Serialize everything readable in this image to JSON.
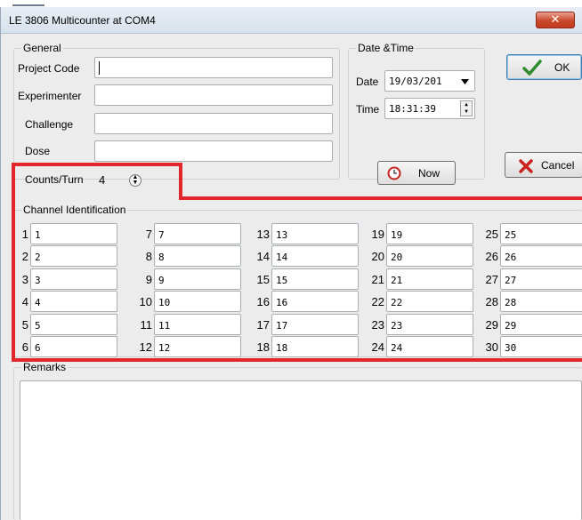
{
  "window": {
    "title": "LE 3806 Multicounter at COM4",
    "close_glyph": "✕"
  },
  "general": {
    "label": "General",
    "project_code_label": "Project Code",
    "project_code_value": "",
    "experimenter_label": "Experimenter",
    "experimenter_value": "",
    "challenge_label": "Challenge",
    "challenge_value": "",
    "dose_label": "Dose",
    "dose_value": "",
    "counts_label": "Counts/Turn",
    "counts_value": "4"
  },
  "datetime": {
    "label": "Date &Time",
    "date_label": "Date",
    "date_value": "19/03/201",
    "time_label": "Time",
    "time_value": "18:31:39",
    "now_label": "Now"
  },
  "buttons": {
    "ok_label": "OK",
    "cancel_label": "Cancel"
  },
  "channels": {
    "label": "Channel Identification",
    "items": [
      {
        "n": "1",
        "v": "1"
      },
      {
        "n": "2",
        "v": "2"
      },
      {
        "n": "3",
        "v": "3"
      },
      {
        "n": "4",
        "v": "4"
      },
      {
        "n": "5",
        "v": "5"
      },
      {
        "n": "6",
        "v": "6"
      },
      {
        "n": "7",
        "v": "7"
      },
      {
        "n": "8",
        "v": "8"
      },
      {
        "n": "9",
        "v": "9"
      },
      {
        "n": "10",
        "v": "10"
      },
      {
        "n": "11",
        "v": "11"
      },
      {
        "n": "12",
        "v": "12"
      },
      {
        "n": "13",
        "v": "13"
      },
      {
        "n": "14",
        "v": "14"
      },
      {
        "n": "15",
        "v": "15"
      },
      {
        "n": "16",
        "v": "16"
      },
      {
        "n": "17",
        "v": "17"
      },
      {
        "n": "18",
        "v": "18"
      },
      {
        "n": "19",
        "v": "19"
      },
      {
        "n": "20",
        "v": "20"
      },
      {
        "n": "21",
        "v": "21"
      },
      {
        "n": "22",
        "v": "22"
      },
      {
        "n": "23",
        "v": "23"
      },
      {
        "n": "24",
        "v": "24"
      },
      {
        "n": "25",
        "v": "25"
      },
      {
        "n": "26",
        "v": "26"
      },
      {
        "n": "27",
        "v": "27"
      },
      {
        "n": "28",
        "v": "28"
      },
      {
        "n": "29",
        "v": "29"
      },
      {
        "n": "30",
        "v": "30"
      }
    ]
  },
  "remarks": {
    "label": "Remarks",
    "value": ""
  },
  "colors": {
    "highlight": "#e3262b",
    "ok_check": "#2e8b2e",
    "cancel_x": "#c8231e",
    "now_clock": "#c8231e"
  },
  "icons": {
    "ok": "checkmark-icon",
    "cancel": "x-icon",
    "now": "clock-icon",
    "dropdown": "chevron-down-icon",
    "spinner": "spinner-icon"
  }
}
